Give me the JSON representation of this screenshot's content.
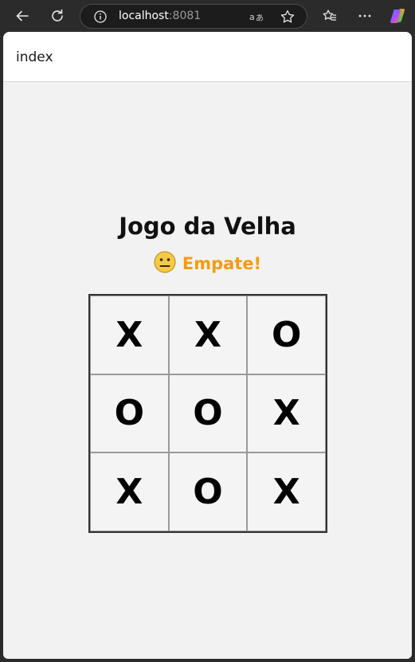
{
  "browser": {
    "url_host": "localhost",
    "url_port": ":8081",
    "icons": {
      "back": "back-arrow-icon",
      "reload": "reload-icon",
      "info": "info-icon",
      "translate": "translate-icon",
      "favorite": "star-icon",
      "favorites_list": "favorites-icon",
      "menu": "more-icon",
      "copilot": "copilot-icon"
    }
  },
  "page": {
    "tab_title": "index"
  },
  "game": {
    "title": "Jogo da Velha",
    "status_emoji": "neutral-face-icon",
    "status_text": "Empate!",
    "status_color": "#f39c12",
    "board": [
      [
        "X",
        "X",
        "O"
      ],
      [
        "O",
        "O",
        "X"
      ],
      [
        "X",
        "O",
        "X"
      ]
    ]
  }
}
